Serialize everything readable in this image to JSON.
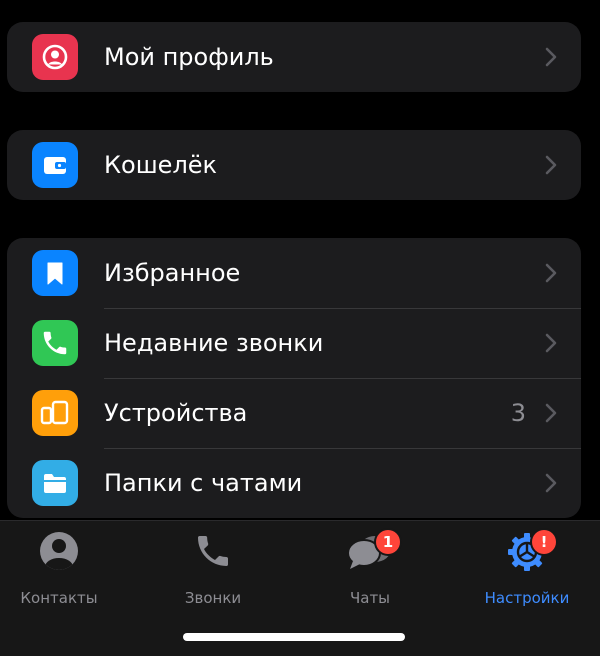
{
  "settings": {
    "groups": [
      {
        "items": [
          {
            "label": "Мой профиль",
            "icon": "person-icon",
            "color": "#e8344f"
          }
        ]
      },
      {
        "items": [
          {
            "label": "Кошелёк",
            "icon": "wallet-icon",
            "color": "#0a84ff"
          }
        ]
      },
      {
        "items": [
          {
            "label": "Избранное",
            "icon": "bookmark-icon",
            "color": "#0a84ff"
          },
          {
            "label": "Недавние звонки",
            "icon": "phone-icon",
            "color": "#30c755"
          },
          {
            "label": "Устройства",
            "icon": "devices-icon",
            "color": "#ff9f0a",
            "value": "3"
          },
          {
            "label": "Папки с чатами",
            "icon": "folder-icon",
            "color": "#32ade6"
          }
        ]
      }
    ]
  },
  "tabbar": {
    "tabs": [
      {
        "label": "Контакты",
        "icon": "contacts-icon",
        "active": false
      },
      {
        "label": "Звонки",
        "icon": "phone-icon",
        "active": false
      },
      {
        "label": "Чаты",
        "icon": "chats-icon",
        "active": false,
        "badge": "1"
      },
      {
        "label": "Настройки",
        "icon": "settings-icon",
        "active": true,
        "badge": "!"
      }
    ]
  },
  "colors": {
    "background": "#000000",
    "group_background": "#1c1c1e",
    "accent": "#3e8cff",
    "inactive": "#8d8d93",
    "badge": "#ff453a"
  }
}
